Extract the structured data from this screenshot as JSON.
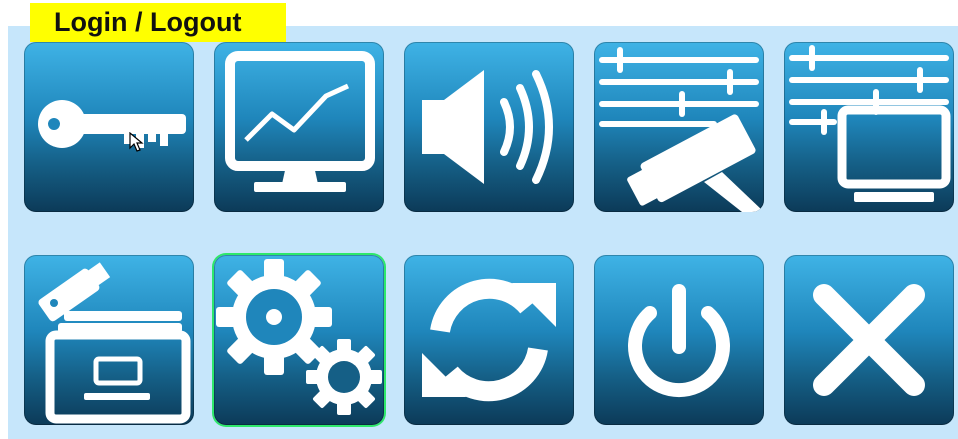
{
  "header": {
    "title": "Login / Logout"
  },
  "colors": {
    "title_bg": "#ffff00",
    "panel_bg": "#c6e6fb",
    "tile_top": "#3fb3e6",
    "tile_bottom": "#0c3a58",
    "icon": "#ffffff",
    "selection_outline": "#2ee86b"
  },
  "tiles": [
    {
      "row": 1,
      "icon": "key-icon"
    },
    {
      "row": 1,
      "icon": "monitor-chart-icon"
    },
    {
      "row": 1,
      "icon": "speaker-icon"
    },
    {
      "row": 1,
      "icon": "camera-settings-icon"
    },
    {
      "row": 1,
      "icon": "display-settings-icon"
    },
    {
      "row": 2,
      "icon": "usb-backup-icon"
    },
    {
      "row": 2,
      "icon": "gears-icon",
      "selected": true
    },
    {
      "row": 2,
      "icon": "refresh-icon"
    },
    {
      "row": 2,
      "icon": "power-icon"
    },
    {
      "row": 2,
      "icon": "close-icon"
    }
  ]
}
